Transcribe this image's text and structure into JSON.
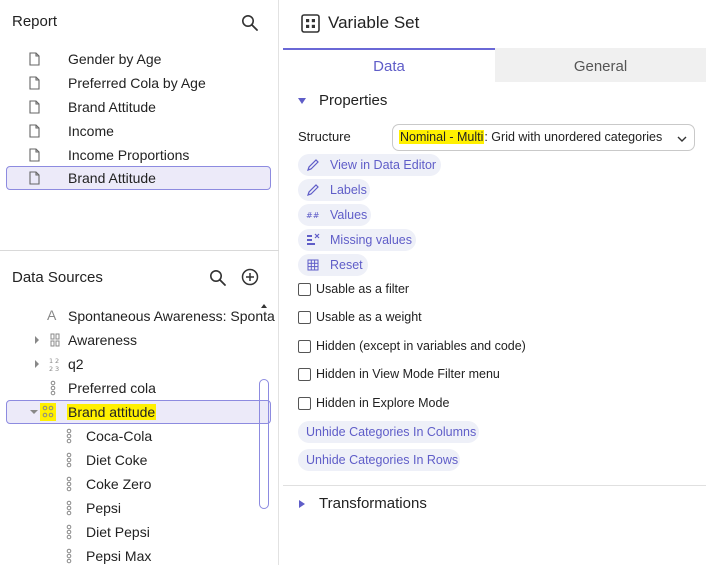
{
  "report": {
    "title": "Report",
    "items": [
      {
        "label": "Gender by Age"
      },
      {
        "label": "Preferred Cola by Age"
      },
      {
        "label": "Brand Attitude"
      },
      {
        "label": "Income"
      },
      {
        "label": "Income Proportions"
      },
      {
        "label": "Brand Attitude",
        "selected": true
      }
    ]
  },
  "data_sources": {
    "title": "Data Sources",
    "items": [
      {
        "label": "Spontaneous Awareness: Sponta",
        "icon": "text-variable-icon"
      },
      {
        "label": "Awareness",
        "icon": "grid-variable-icon",
        "expandable": true
      },
      {
        "label": "q2",
        "icon": "numeric-grid-icon",
        "expandable": true
      },
      {
        "label": "Preferred cola",
        "icon": "categorical-icon"
      },
      {
        "label": "Brand attitude",
        "icon": "grid-categorical-icon",
        "expanded": true,
        "selected": true,
        "highlighted": true
      },
      {
        "label": "Coca-Cola",
        "icon": "categorical-icon",
        "child": true
      },
      {
        "label": "Diet Coke",
        "icon": "categorical-icon",
        "child": true
      },
      {
        "label": "Coke Zero",
        "icon": "categorical-icon",
        "child": true
      },
      {
        "label": "Pepsi",
        "icon": "categorical-icon",
        "child": true
      },
      {
        "label": "Diet Pepsi",
        "icon": "categorical-icon",
        "child": true
      },
      {
        "label": "Pepsi Max",
        "icon": "categorical-icon",
        "child": true
      }
    ]
  },
  "panel": {
    "title": "Variable Set",
    "tabs": [
      {
        "label": "Data",
        "active": true
      },
      {
        "label": "General",
        "active": false
      }
    ],
    "properties": {
      "heading": "Properties",
      "structure_label": "Structure",
      "structure_value_highlight": "Nominal - Multi",
      "structure_value_rest": ": Grid with unordered categories",
      "actions": [
        {
          "label": "View in Data Editor",
          "icon": "pencil-icon"
        },
        {
          "label": "Labels",
          "icon": "pencil-icon"
        },
        {
          "label": "Values",
          "icon": "values-icon"
        },
        {
          "label": "Missing values",
          "icon": "missing-values-icon"
        },
        {
          "label": "Reset",
          "icon": "reset-icon"
        }
      ],
      "checkboxes": [
        {
          "label": "Usable as a filter",
          "checked": false
        },
        {
          "label": "Usable as a weight",
          "checked": false
        },
        {
          "label": "Hidden (except in variables and code)",
          "checked": false
        },
        {
          "label": "Hidden in View Mode Filter menu",
          "checked": false
        },
        {
          "label": "Hidden in Explore Mode",
          "checked": false
        }
      ],
      "unhide_columns": "Unhide Categories In Columns",
      "unhide_rows": "Unhide Categories In Rows"
    },
    "transformations": {
      "heading": "Transformations"
    }
  },
  "colors": {
    "accent": "#5f5dc8",
    "selection_border": "#8d8be0",
    "selection_bg": "#eceaf9",
    "highlight": "#fff000"
  }
}
